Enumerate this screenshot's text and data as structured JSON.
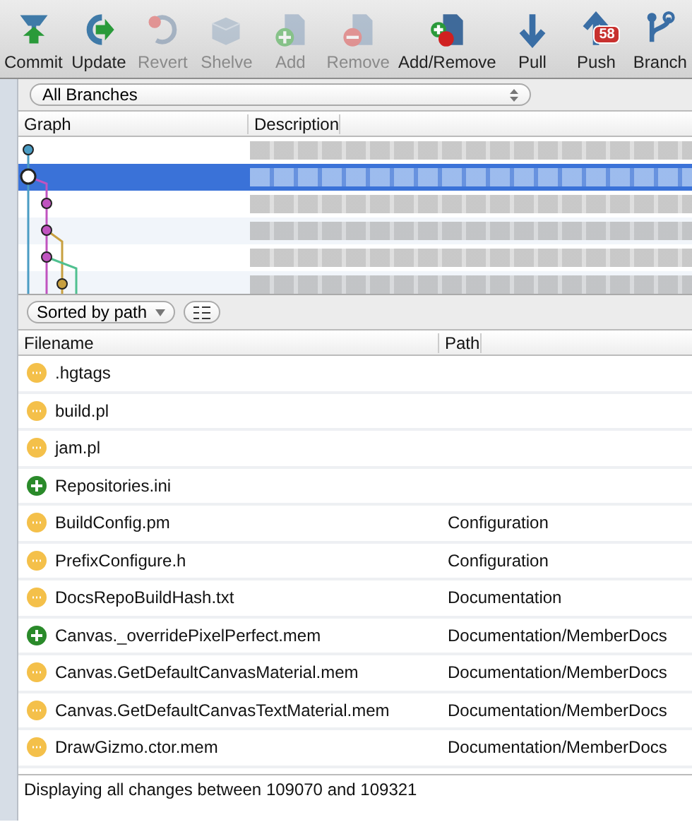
{
  "toolbar": [
    {
      "label": "Commit",
      "disabled": false
    },
    {
      "label": "Update",
      "disabled": false
    },
    {
      "label": "Revert",
      "disabled": true
    },
    {
      "label": "Shelve",
      "disabled": true
    },
    {
      "label": "Add",
      "disabled": true
    },
    {
      "label": "Remove",
      "disabled": true
    },
    {
      "label": "Add/Remove",
      "disabled": false
    },
    {
      "label": "Pull",
      "disabled": false
    },
    {
      "label": "Push",
      "disabled": false,
      "badge": "58"
    },
    {
      "label": "Branch",
      "disabled": false
    }
  ],
  "branch_filter": {
    "value": "All Branches"
  },
  "commits": {
    "columns": [
      "Graph",
      "Description"
    ],
    "rows": [
      {
        "selected": false
      },
      {
        "selected": true
      },
      {
        "selected": false
      },
      {
        "selected": false
      },
      {
        "selected": false
      },
      {
        "selected": false
      }
    ]
  },
  "sort_control": {
    "value": "Sorted by path"
  },
  "files": {
    "columns": [
      "Filename",
      "Path"
    ],
    "rows": [
      {
        "kind": "modified",
        "filename": ".hgtags",
        "path": ""
      },
      {
        "kind": "modified",
        "filename": "build.pl",
        "path": ""
      },
      {
        "kind": "modified",
        "filename": "jam.pl",
        "path": ""
      },
      {
        "kind": "added",
        "filename": "Repositories.ini",
        "path": ""
      },
      {
        "kind": "modified",
        "filename": "BuildConfig.pm",
        "path": "Configuration"
      },
      {
        "kind": "modified",
        "filename": "PrefixConfigure.h",
        "path": "Configuration"
      },
      {
        "kind": "modified",
        "filename": "DocsRepoBuildHash.txt",
        "path": "Documentation"
      },
      {
        "kind": "added",
        "filename": "Canvas._overridePixelPerfect.mem",
        "path": "Documentation/MemberDocs"
      },
      {
        "kind": "modified",
        "filename": "Canvas.GetDefaultCanvasMaterial.mem",
        "path": "Documentation/MemberDocs"
      },
      {
        "kind": "modified",
        "filename": "Canvas.GetDefaultCanvasTextMaterial.mem",
        "path": "Documentation/MemberDocs"
      },
      {
        "kind": "modified",
        "filename": "DrawGizmo.ctor.mem",
        "path": "Documentation/MemberDocs"
      }
    ]
  },
  "status_bar": "Displaying all changes between 109070 and 109321"
}
